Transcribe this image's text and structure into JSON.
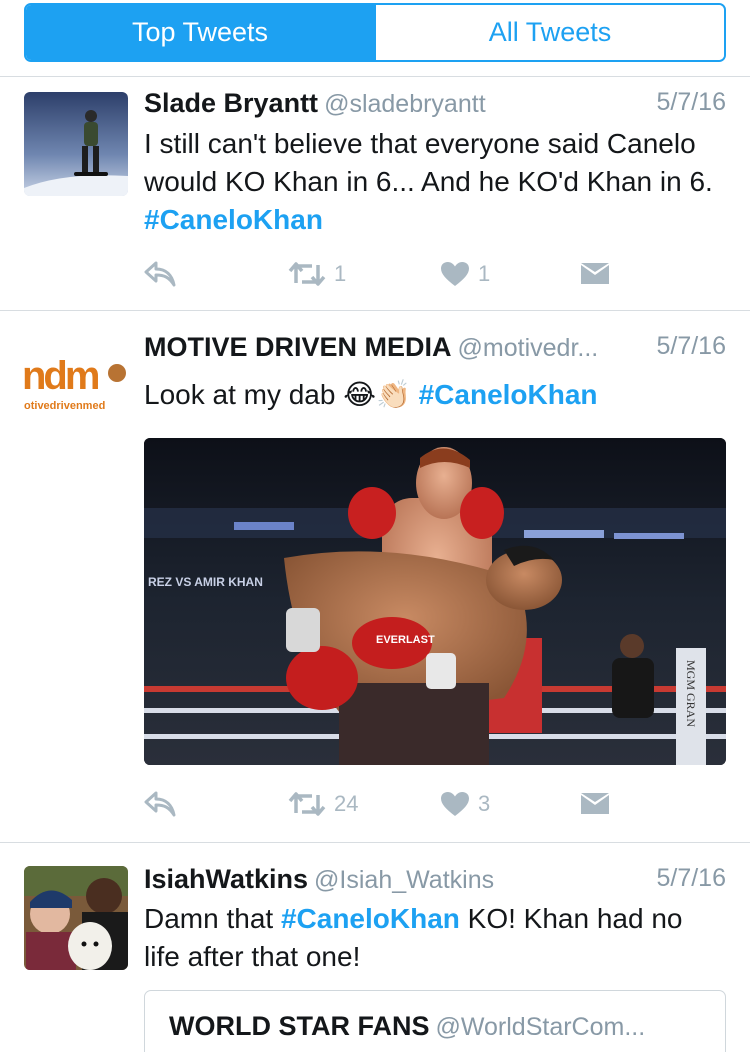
{
  "tabs": {
    "top": "Top Tweets",
    "all": "All Tweets",
    "active": "top"
  },
  "tweets": [
    {
      "name": "Slade Bryantt",
      "handle": "@sladebryantt",
      "date": "5/7/16",
      "text": "I still can't believe that everyone said Canelo would KO Khan in 6... And he KO'd Khan in 6.",
      "hashtag": "#CaneloKhan",
      "retweets": "1",
      "likes": "1"
    },
    {
      "name": "MOTIVE DRIVEN MEDIA",
      "handle": "@motivedr...",
      "date": "5/7/16",
      "text": "Look at my dab",
      "emoji": "😂👏🏻",
      "hashtag": "#CaneloKhan",
      "avatar_logo": "ndm",
      "avatar_sub": "otivedrivenmed",
      "retweets": "24",
      "likes": "3",
      "photo_banner": "REZ VS AMIR KHAN",
      "photo_glove_brand": "EVERLAST",
      "photo_sign": "MGM GRAN"
    },
    {
      "name": "IsiahWatkins",
      "handle": "@Isiah_Watkins",
      "date": "5/7/16",
      "text_before": "Damn that",
      "hashtag": "#CaneloKhan",
      "text_after": "KO! Khan had no life after that one!",
      "quote": {
        "name": "WORLD STAR FANS",
        "handle": "@WorldStarCom..."
      }
    }
  ],
  "colors": {
    "accent": "#1da1f2",
    "muted": "#8899a6",
    "icon": "#aab8c2",
    "divider": "#d8dde1"
  },
  "icons": [
    "reply-icon",
    "retweet-icon",
    "like-icon",
    "direct-message-icon"
  ]
}
